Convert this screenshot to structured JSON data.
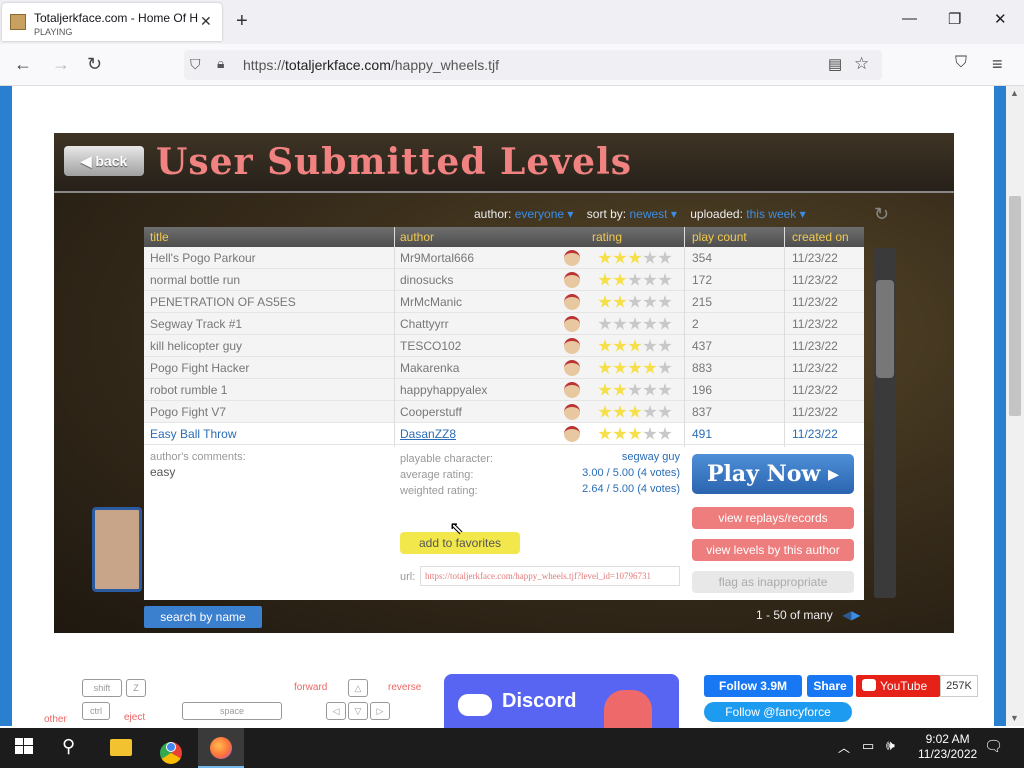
{
  "browser": {
    "tab_title": "Totaljerkface.com - Home Of H",
    "tab_status": "PLAYING",
    "url_prefix": "https://",
    "url_host": "totaljerkface.com",
    "url_path": "/happy_wheels.tjf"
  },
  "game": {
    "back_label": "◀ back",
    "title": "User Submitted Levels",
    "filters": {
      "author_label": "author:",
      "author_value": "everyone ▾",
      "sort_label": "sort by:",
      "sort_value": "newest ▾",
      "uploaded_label": "uploaded:",
      "uploaded_value": "this week ▾"
    },
    "columns": [
      "title",
      "author",
      "rating",
      "play count",
      "created on"
    ],
    "rows": [
      {
        "title": "Hell's Pogo Parkour",
        "author": "Mr9Mortal666",
        "stars": 3,
        "plays": "354",
        "date": "11/23/22"
      },
      {
        "title": "normal bottle run",
        "author": "dinosucks",
        "stars": 2,
        "plays": "172",
        "date": "11/23/22"
      },
      {
        "title": "PENETRATION OF AS5ES",
        "author": "MrMcManic",
        "stars": 2,
        "plays": "215",
        "date": "11/23/22"
      },
      {
        "title": "Segway Track #1",
        "author": "Chattyyrr",
        "stars": 0,
        "plays": "2",
        "date": "11/23/22"
      },
      {
        "title": "kill helicopter guy",
        "author": "TESCO102",
        "stars": 3,
        "plays": "437",
        "date": "11/23/22"
      },
      {
        "title": "Pogo Fight Hacker",
        "author": "Makarenka",
        "stars": 4,
        "plays": "883",
        "date": "11/23/22"
      },
      {
        "title": "robot rumble 1",
        "author": "happyhappyalex",
        "stars": 2,
        "plays": "196",
        "date": "11/23/22"
      },
      {
        "title": "Pogo Fight V7",
        "author": "Cooperstuff",
        "stars": 3,
        "plays": "837",
        "date": "11/23/22"
      },
      {
        "title": "Easy Ball Throw",
        "author": "DasanZZ8",
        "stars": 3,
        "plays": "491",
        "date": "11/23/22"
      }
    ],
    "detail": {
      "comments_label": "author's comments:",
      "comments": "easy",
      "character_label": "playable character:",
      "character": "segway guy",
      "avg_label": "average rating:",
      "avg": "3.00 / 5.00 (4 votes)",
      "weighted_label": "weighted rating:",
      "weighted": "2.64 / 5.00 (4 votes)",
      "favorites": "add to favorites",
      "url_label": "url:",
      "url": "https://totaljerkface.com/happy_wheels.tjf?level_id=10796731",
      "play_now": "Play Now ▸",
      "replays": "view replays/records",
      "levels_by_author": "view levels by this author",
      "flag": "flag as inappropriate"
    },
    "search_by_name": "search by name",
    "pager": "1 - 50 of many"
  },
  "controls": {
    "shift": "shift",
    "z": "Z",
    "ctrl": "ctrl",
    "other": "other",
    "eject": "eject",
    "space": "space",
    "forward": "forward",
    "reverse": "reverse"
  },
  "social": {
    "discord": "Discord",
    "fb_follow": "Follow 3.9M",
    "fb_share": "Share",
    "youtube": "YouTube",
    "youtube_count": "257K",
    "twitter": "Follow @fancyforce"
  },
  "taskbar": {
    "time": "9:02 AM",
    "date": "11/23/2022"
  }
}
